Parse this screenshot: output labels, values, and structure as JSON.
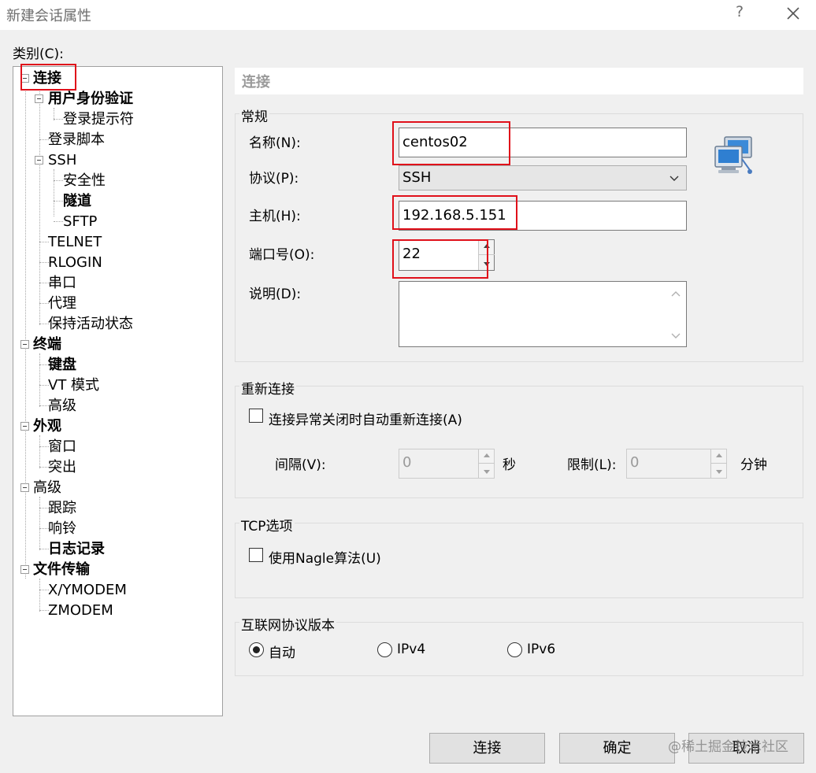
{
  "window": {
    "title": "新建会话属性",
    "help": "?"
  },
  "category_label": "类别(C):",
  "tree": {
    "connection": "连接",
    "user_auth": "用户身份验证",
    "login_prompt": "登录提示符",
    "login_script": "登录脚本",
    "ssh": "SSH",
    "security": "安全性",
    "tunnel": "隧道",
    "sftp": "SFTP",
    "telnet": "TELNET",
    "rlogin": "RLOGIN",
    "serial": "串口",
    "proxy": "代理",
    "keepalive": "保持活动状态",
    "terminal": "终端",
    "keyboard": "键盘",
    "vt_mode": "VT 模式",
    "term_advanced": "高级",
    "appearance": "外观",
    "window": "窗口",
    "highlight": "突出",
    "advanced": "高级",
    "trace": "跟踪",
    "bell": "响铃",
    "logging": "日志记录",
    "file_transfer": "文件传输",
    "xymodem": "X/YMODEM",
    "zmodem": "ZMODEM"
  },
  "page_title": "连接",
  "general": {
    "label": "常规",
    "name_label": "名称(N):",
    "name_value": "centos02",
    "protocol_label": "协议(P):",
    "protocol_value": "SSH",
    "host_label": "主机(H):",
    "host_value": "192.168.5.151",
    "port_label": "端口号(O):",
    "port_value": "22",
    "desc_label": "说明(D):",
    "desc_value": ""
  },
  "reconnect": {
    "label": "重新连接",
    "auto_reconnect": "连接异常关闭时自动重新连接(A)",
    "interval_label": "间隔(V):",
    "interval_value": "0",
    "interval_unit": "秒",
    "limit_label": "限制(L):",
    "limit_value": "0",
    "limit_unit": "分钟"
  },
  "tcp": {
    "label": "TCP选项",
    "nagle": "使用Nagle算法(U)"
  },
  "ip_version": {
    "label": "互联网协议版本",
    "auto": "自动",
    "ipv4": "IPv4",
    "ipv6": "IPv6",
    "selected": "自动"
  },
  "buttons": {
    "connect": "连接",
    "ok": "确定",
    "cancel": "取消"
  },
  "watermark": "@稀土掘金技术社区",
  "colors": {
    "highlight": "#e0101a",
    "background": "#f0f0f0"
  },
  "icons": {
    "session": "network-computers-icon"
  }
}
